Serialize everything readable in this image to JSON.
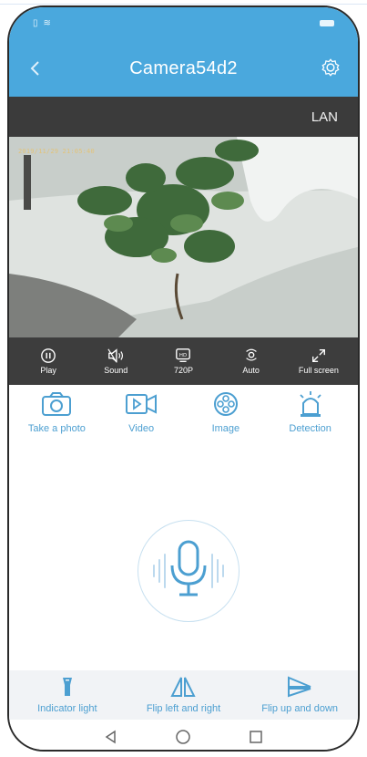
{
  "colors": {
    "header_blue": "#4aa8dd",
    "accent_blue": "#4c9fd1",
    "dark_bar": "#3b3b3b",
    "control_bar": "#3d3d3d"
  },
  "header": {
    "title": "Camera54d2",
    "back_icon": "chevron-left-icon",
    "settings_icon": "gear-icon"
  },
  "connection": {
    "label": "LAN"
  },
  "video": {
    "timestamp": "2019/11/29 21:05:40"
  },
  "controls": [
    {
      "label": "Play",
      "icon": "pause-circle-icon"
    },
    {
      "label": "Sound",
      "icon": "speaker-muted-icon"
    },
    {
      "label": "720P",
      "icon": "hd-icon"
    },
    {
      "label": "Auto",
      "icon": "auto-mode-icon"
    },
    {
      "label": "Full screen",
      "icon": "expand-icon"
    }
  ],
  "features": [
    {
      "label": "Take a photo",
      "icon": "camera-icon"
    },
    {
      "label": "Video",
      "icon": "video-icon"
    },
    {
      "label": "Image",
      "icon": "film-reel-icon"
    },
    {
      "label": "Detection",
      "icon": "alarm-light-icon"
    }
  ],
  "mic": {
    "icon": "microphone-icon"
  },
  "tools": [
    {
      "label": "Indicator light",
      "icon": "flashlight-icon"
    },
    {
      "label": "Flip left and right",
      "icon": "flip-horizontal-icon"
    },
    {
      "label": "Flip up and down",
      "icon": "flip-vertical-icon"
    }
  ]
}
